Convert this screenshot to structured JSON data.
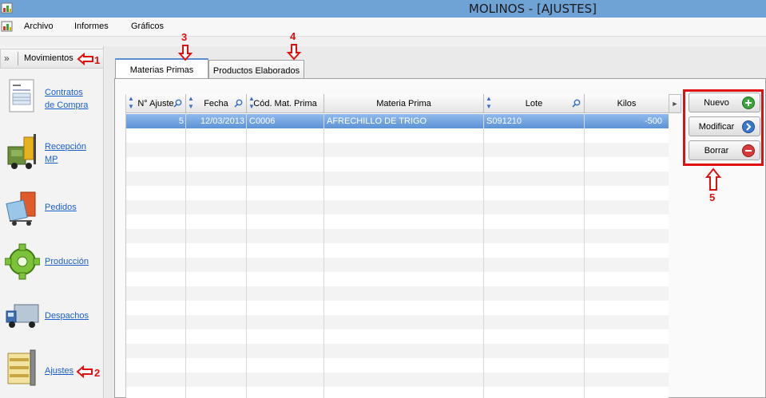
{
  "window": {
    "title": "MOLINOS - [AJUSTES]"
  },
  "menu": {
    "items": [
      "Archivo",
      "Informes",
      "Gráficos"
    ]
  },
  "sidebar": {
    "header": "Movimientos",
    "items": [
      {
        "label_line1": "Contratos",
        "label_line2": "de Compra",
        "icon": "contract-icon"
      },
      {
        "label_line1": "Recepción",
        "label_line2": "MP",
        "icon": "forklift-icon"
      },
      {
        "label_line1": "Pedidos",
        "label_line2": "",
        "icon": "cart-icon"
      },
      {
        "label_line1": "Producción",
        "label_line2": "",
        "icon": "gear-icon"
      },
      {
        "label_line1": "Despachos",
        "label_line2": "",
        "icon": "truck-icon"
      },
      {
        "label_line1": "Ajustes",
        "label_line2": "",
        "icon": "vise-icon"
      }
    ]
  },
  "tabs": [
    {
      "label": "Materias Primas",
      "active": true
    },
    {
      "label": "Productos Elaborados",
      "active": false
    }
  ],
  "grid": {
    "columns": [
      "N° Ajuste",
      "Fecha",
      "Cód. Mat. Prima",
      "Materia Prima",
      "Lote",
      "Kilos"
    ],
    "rows": [
      [
        "5",
        "12/03/2013",
        "C0006",
        "AFRECHILLO DE TRIGO",
        "S091210",
        "-500"
      ]
    ]
  },
  "buttons": {
    "nuevo": "Nuevo",
    "modificar": "Modificar",
    "borrar": "Borrar"
  },
  "annotations": {
    "a1": "1",
    "a2": "2",
    "a3": "3",
    "a4": "4",
    "a5": "5"
  },
  "colors": {
    "accent": "#e01010",
    "selection": "#5d93d6",
    "titlebar": "#6fa3d6"
  }
}
